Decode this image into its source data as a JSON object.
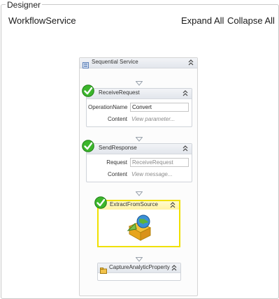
{
  "panel": {
    "title": "Designer"
  },
  "toolbar": {
    "workflow_name": "WorkflowService",
    "expand_all": "Expand All",
    "collapse_all": "Collapse All"
  },
  "sequence": {
    "label": "Sequential Service"
  },
  "activities": [
    {
      "label": "ReceiveRequest",
      "rows": [
        {
          "label": "OperationName",
          "value": "Convert"
        },
        {
          "label": "Content",
          "placeholder": "View parameter..."
        }
      ]
    },
    {
      "label": "SendResponse",
      "rows": [
        {
          "label": "Request",
          "value": "ReceiveRequest"
        },
        {
          "label": "Content",
          "placeholder": "View message..."
        }
      ]
    },
    {
      "label": "ExtractFromSource"
    },
    {
      "label": "CaptureAnalyticProperty"
    }
  ],
  "colors": {
    "selection_border": "#f0e000",
    "check_green": "#3cb62c"
  },
  "icons": [
    "sequence-icon",
    "checkmark-icon",
    "collapse-chevron-icon",
    "down-arrow-icon",
    "globe-package-icon",
    "property-icon"
  ]
}
